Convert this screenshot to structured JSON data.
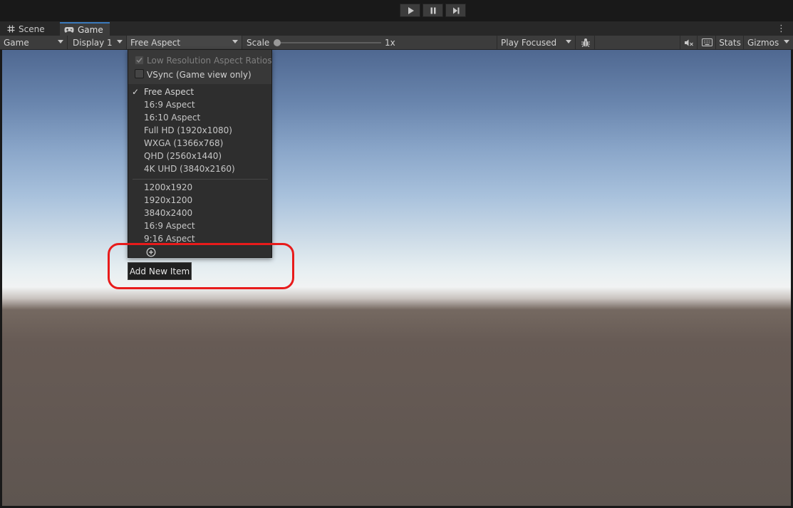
{
  "tabs": {
    "scene": "Scene",
    "game": "Game",
    "menu_glyph": "⋮"
  },
  "toolbar": {
    "view_mode": "Game",
    "display": "Display 1",
    "aspect": "Free Aspect",
    "scale_label": "Scale",
    "scale_value": "1x",
    "play_mode": "Play Focused",
    "stats": "Stats",
    "gizmos": "Gizmos"
  },
  "dropdown": {
    "low_res_label": "Low Resolution Aspect Ratios",
    "low_res_checked": true,
    "low_res_disabled": true,
    "vsync_label": "VSync (Game view only)",
    "vsync_checked": false,
    "selected_marker": "✓",
    "builtin_items": [
      "Free Aspect",
      "16:9 Aspect",
      "16:10 Aspect",
      "Full HD (1920x1080)",
      "WXGA (1366x768)",
      "QHD (2560x1440)",
      "4K UHD (3840x2160)"
    ],
    "custom_items": [
      "1200x1920",
      "1920x1200",
      "3840x2400",
      "16:9 Aspect",
      "9:16 Aspect"
    ]
  },
  "tooltip": {
    "text": "Add New Item"
  },
  "colors": {
    "highlight": "#e81b1b",
    "tab_accent": "#3a79bb"
  }
}
